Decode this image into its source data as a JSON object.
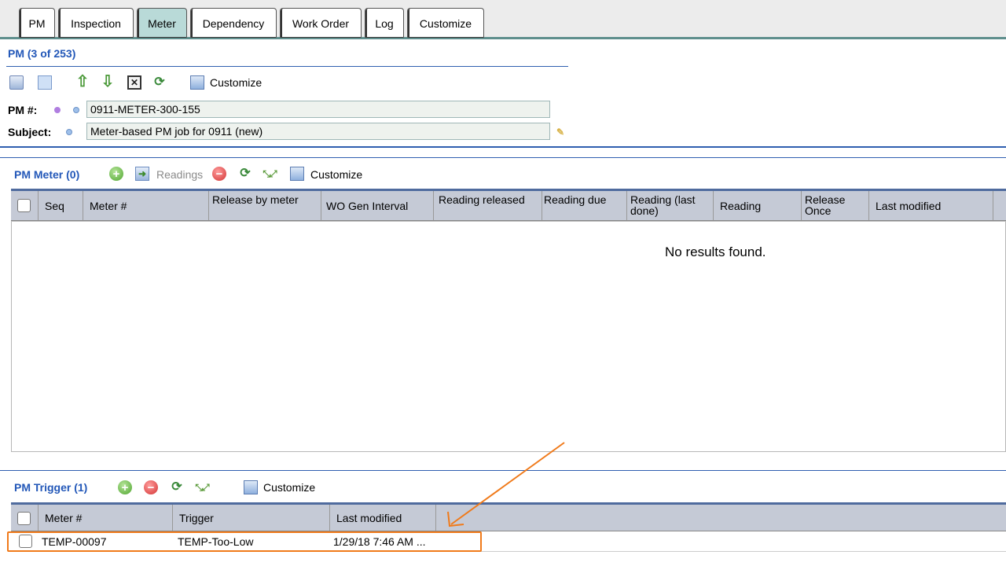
{
  "tabs": [
    {
      "label": "PM"
    },
    {
      "label": "Inspection"
    },
    {
      "label": "Meter"
    },
    {
      "label": "Dependency"
    },
    {
      "label": "Work Order"
    },
    {
      "label": "Log"
    },
    {
      "label": "Customize"
    }
  ],
  "pm_header": {
    "title": "PM (3 of 253)",
    "customize_label": "Customize"
  },
  "fields": {
    "pm_number_label": "PM #:",
    "pm_number_value": "0911-METER-300-155",
    "subject_label": "Subject:",
    "subject_value": "Meter-based PM job for 0911 (new)"
  },
  "pm_meter": {
    "title": "PM Meter (0)",
    "readings_label": "Readings",
    "customize_label": "Customize",
    "columns": [
      {
        "label": "Seq"
      },
      {
        "label": "Meter #"
      },
      {
        "label": "Release by meter"
      },
      {
        "label": "WO Gen Interval"
      },
      {
        "label": "Reading released"
      },
      {
        "label": "Reading due"
      },
      {
        "label": "Reading (last done)"
      },
      {
        "label": "Reading"
      },
      {
        "label": "Release Once"
      },
      {
        "label": "Last modified"
      }
    ],
    "empty_message": "No results found."
  },
  "pm_trigger": {
    "title": "PM Trigger (1)",
    "customize_label": "Customize",
    "columns": [
      {
        "label": "Meter #"
      },
      {
        "label": "Trigger"
      },
      {
        "label": "Last modified"
      }
    ],
    "rows": [
      {
        "meter": "TEMP-00097",
        "trigger": "TEMP-Too-Low",
        "last_modified": "1/29/18 7:46 AM ..."
      }
    ]
  },
  "annotation_colors": {
    "highlight": "#f07a1a"
  }
}
